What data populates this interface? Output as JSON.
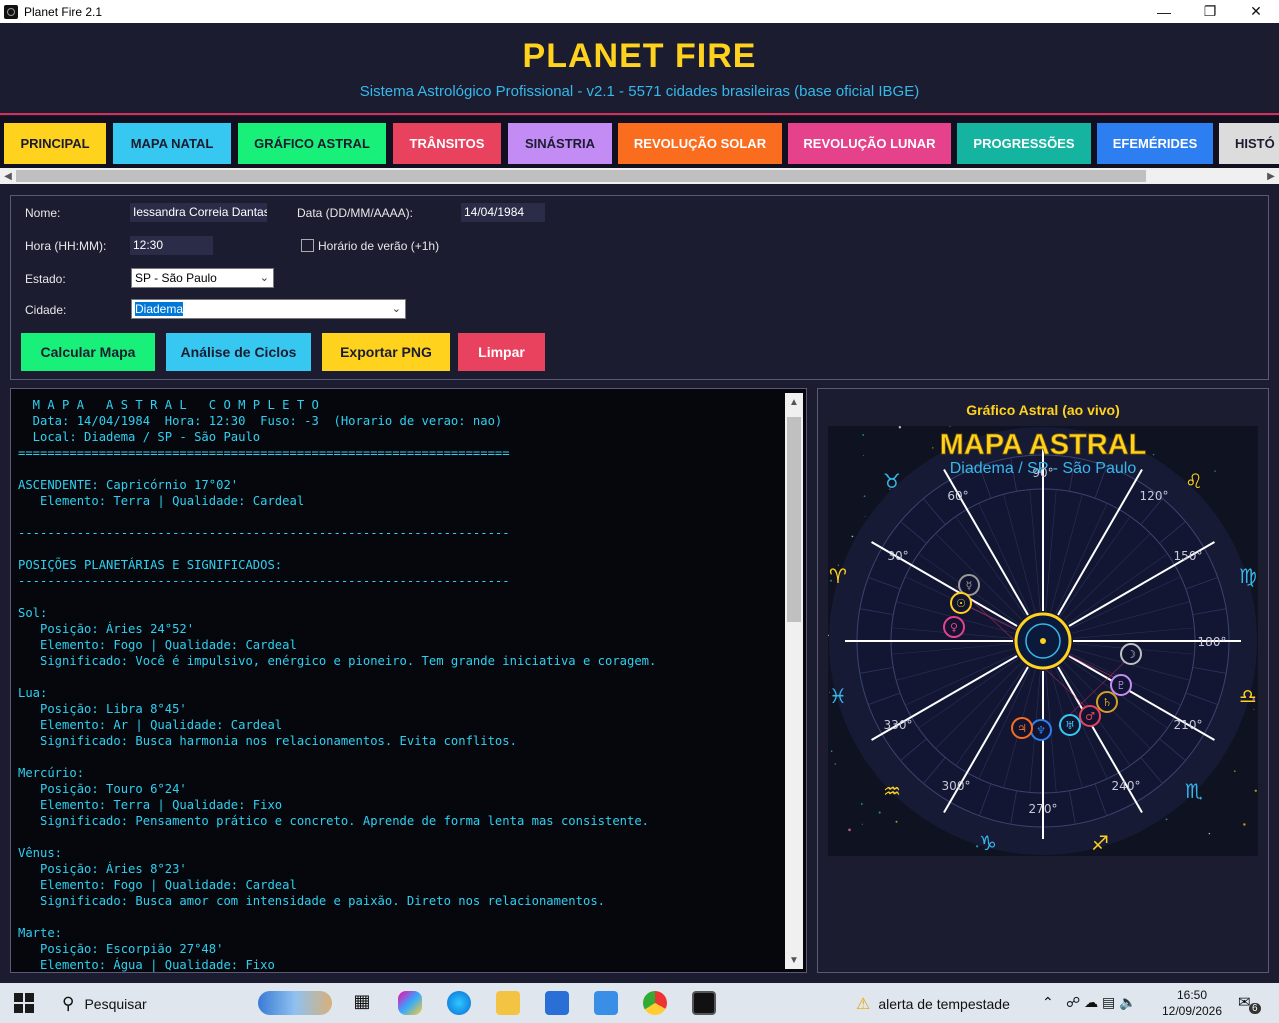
{
  "window": {
    "title": "Planet Fire 2.1",
    "minimize": "—",
    "maximize": "❐",
    "close": "✕"
  },
  "header": {
    "title": "PLANET FIRE",
    "subtitle": "Sistema Astrológico Profissional - v2.1 - 5571 cidades brasileiras (base oficial IBGE)"
  },
  "tabs": [
    {
      "label": "PRINCIPAL",
      "bg": "#ffd21e",
      "fg": "#1b1c30"
    },
    {
      "label": "MAPA NATAL",
      "bg": "#36c8f0",
      "fg": "#1b1c30"
    },
    {
      "label": "GRÁFICO ASTRAL",
      "bg": "#19f07a",
      "fg": "#1b1c30"
    },
    {
      "label": "TRÂNSITOS",
      "bg": "#e8425f",
      "fg": "#ffffff"
    },
    {
      "label": "SINÁSTRIA",
      "bg": "#c38cf5",
      "fg": "#1b1c30"
    },
    {
      "label": "REVOLUÇÃO SOLAR",
      "bg": "#fa6c1e",
      "fg": "#ffffff"
    },
    {
      "label": "REVOLUÇÃO LUNAR",
      "bg": "#e6428c",
      "fg": "#ffffff"
    },
    {
      "label": "PROGRESSÕES",
      "bg": "#14b4a0",
      "fg": "#ffffff"
    },
    {
      "label": "EFEMÉRIDES",
      "bg": "#2d7ef0",
      "fg": "#ffffff"
    },
    {
      "label": "HISTÓ",
      "bg": "#dcdcdc",
      "fg": "#1b1c30"
    }
  ],
  "form": {
    "name_label": "Nome:",
    "name_value": "Iessandra Correia Dantas",
    "date_label": "Data (DD/MM/AAAA):",
    "date_value": "14/04/1984",
    "time_label": "Hora (HH:MM):",
    "time_value": "12:30",
    "dst_label": "Horário de verão (+1h)",
    "state_label": "Estado:",
    "state_value": "SP - São Paulo",
    "city_label": "Cidade:",
    "city_value": "Diadema"
  },
  "buttons": {
    "calc": "Calcular Mapa",
    "cycles": "Análise de Ciclos",
    "export": "Exportar PNG",
    "clear": "Limpar"
  },
  "report_lines": [
    "  M A P A   A S T R A L   C O M P L E T O",
    "  Data: 14/04/1984  Hora: 12:30  Fuso: -3  (Horario de verao: nao)",
    "  Local: Diadema / SP - São Paulo",
    "===================================================================",
    "",
    "ASCENDENTE: Capricórnio 17°02'",
    "   Elemento: Terra | Qualidade: Cardeal",
    "",
    "-------------------------------------------------------------------",
    "",
    "POSIÇÕES PLANETÁRIAS E SIGNIFICADOS:",
    "-------------------------------------------------------------------",
    "",
    "Sol:",
    "   Posição: Áries 24°52'",
    "   Elemento: Fogo | Qualidade: Cardeal",
    "   Significado: Você é impulsivo, enérgico e pioneiro. Tem grande iniciativa e coragem.",
    "",
    "Lua:",
    "   Posição: Libra 8°45'",
    "   Elemento: Ar | Qualidade: Cardeal",
    "   Significado: Busca harmonia nos relacionamentos. Evita conflitos.",
    "",
    "Mercúrio:",
    "   Posição: Touro 6°24'",
    "   Elemento: Terra | Qualidade: Fixo",
    "   Significado: Pensamento prático e concreto. Aprende de forma lenta mas consistente.",
    "",
    "Vênus:",
    "   Posição: Áries 8°23'",
    "   Elemento: Fogo | Qualidade: Cardeal",
    "   Significado: Busca amor com intensidade e paixão. Direto nos relacionamentos.",
    "",
    "Marte:",
    "   Posição: Escorpião 27°48'",
    "   Elemento: Água | Qualidade: Fixo"
  ],
  "chart": {
    "panel_title": "Gráfico Astral (ao vivo)",
    "title": "MAPA ASTRAL",
    "subtitle": "Diadema / SP - São Paulo",
    "degree_labels": [
      "90°",
      "120°",
      "150°",
      "180°",
      "210°",
      "240°",
      "270°",
      "300°",
      "330°",
      "30°",
      "60°"
    ],
    "signs": [
      "♈",
      "♉",
      "♊",
      "♋",
      "♌",
      "♍",
      "♎",
      "♏",
      "♐",
      "♑",
      "♒",
      "♓"
    ],
    "gold": "#ffd21e",
    "cyan": "#36b8ea"
  },
  "taskbar": {
    "search": "Pesquisar",
    "weather": "alerta de tempestade",
    "time": "16:50",
    "date": "12/09/2026",
    "notif": "6"
  }
}
